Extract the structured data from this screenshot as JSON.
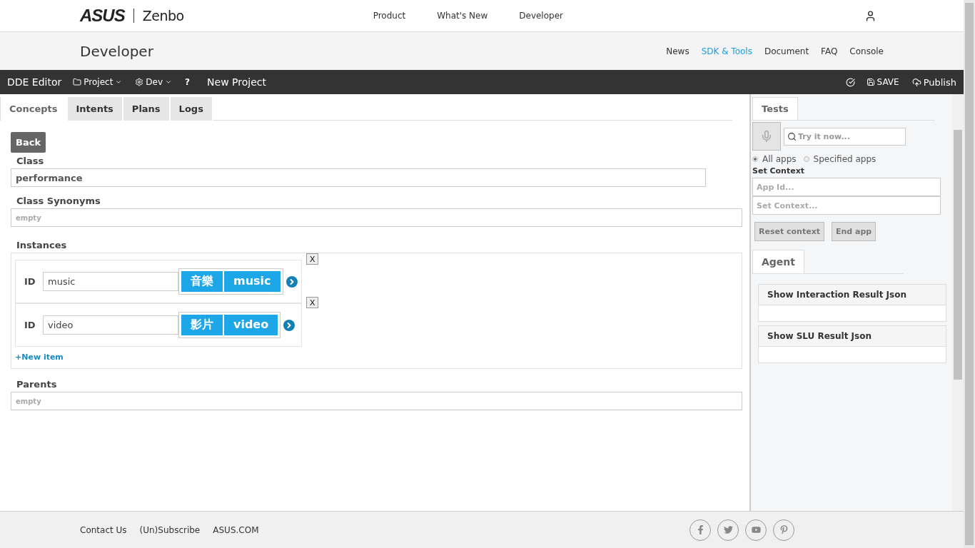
{
  "brand": {
    "logo": "ASUS",
    "product": "Zenbo"
  },
  "top_nav": [
    {
      "label": "Product"
    },
    {
      "label": "What's New"
    },
    {
      "label": "Developer"
    }
  ],
  "section": {
    "title": "Developer"
  },
  "section_nav": [
    {
      "label": "News",
      "selected": false
    },
    {
      "label": "SDK & Tools",
      "selected": true
    },
    {
      "label": "Document",
      "selected": false
    },
    {
      "label": "FAQ",
      "selected": false
    },
    {
      "label": "Console",
      "selected": false
    }
  ],
  "toolbar": {
    "title": "DDE Editor",
    "project_menu": "Project",
    "dev_menu": "Dev",
    "help": "?",
    "project_name": "New Project",
    "save": "SAVE",
    "publish": "Publish"
  },
  "tabs": [
    {
      "label": "Concepts",
      "selected": true
    },
    {
      "label": "Intents",
      "selected": false
    },
    {
      "label": "Plans",
      "selected": false
    },
    {
      "label": "Logs",
      "selected": false
    }
  ],
  "editor": {
    "back": "Back",
    "class_label": "Class",
    "class_value": "performance",
    "synonyms_label": "Class Synonyms",
    "synonyms_placeholder": "empty",
    "instances_label": "Instances",
    "instances": [
      {
        "id_label": "ID",
        "value": "music",
        "tags": [
          "音樂",
          "music"
        ],
        "remove": "X"
      },
      {
        "id_label": "ID",
        "value": "video",
        "tags": [
          "影片",
          "video"
        ],
        "remove": "X"
      }
    ],
    "new_item": "+New item",
    "parents_label": "Parents",
    "parents_placeholder": "empty"
  },
  "tests": {
    "tab": "Tests",
    "search_placeholder": "Try it now...",
    "scope": [
      {
        "label": "All apps",
        "selected": true
      },
      {
        "label": "Specified apps",
        "selected": false
      }
    ],
    "context_label": "Set Context",
    "app_id_placeholder": "App Id...",
    "context_placeholder": "Set Context...",
    "buttons": [
      "Reset context",
      "End app"
    ],
    "agent_tab": "Agent",
    "panels": [
      {
        "title": "Show Interaction Result Json"
      },
      {
        "title": "Show SLU Result Json"
      }
    ]
  },
  "footer": {
    "links": [
      "Contact Us",
      "(Un)Subscribe",
      "ASUS.COM"
    ]
  }
}
